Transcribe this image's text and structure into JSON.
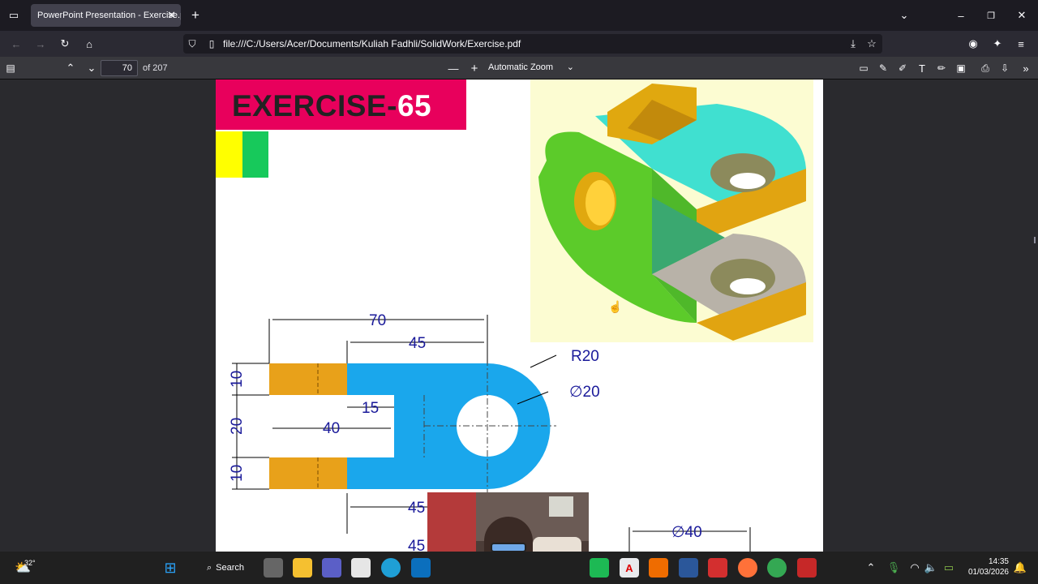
{
  "browser": {
    "tab_title": "PowerPoint Presentation - Exercise.p",
    "url": "file:///C:/Users/Acer/Documents/Kuliah Fadhli/SolidWork/Exercise.pdf"
  },
  "pdf_toolbar": {
    "page_number": "70",
    "page_total": "of 207",
    "zoom_label": "Automatic Zoom"
  },
  "exercise": {
    "title_prefix": "EXERCISE-",
    "title_number": "65"
  },
  "dimensions": {
    "d70": "70",
    "d45_top": "45",
    "r20": "R20",
    "dia20": "∅20",
    "d10_top": "10",
    "d20": "20",
    "d10_bottom": "10",
    "d15": "15",
    "d40": "40",
    "d45_bottom": "45",
    "d45_bottom2": "45",
    "dia40": "∅40"
  },
  "taskbar": {
    "weather": "32°",
    "search_label": "Search",
    "time": "14:35",
    "date": "01/03/2026"
  },
  "colors": {
    "banner": "#e8005c",
    "part_blue": "#1aa7ec",
    "part_orange": "#e8a11a",
    "dim_text": "#1a1a9a"
  }
}
